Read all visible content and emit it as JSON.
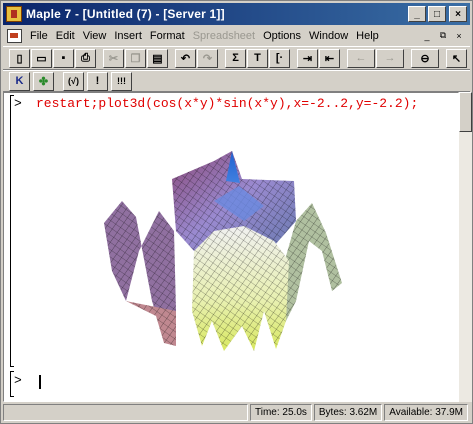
{
  "window": {
    "title": "Maple 7 - [Untitled (7) - [Server 1]]",
    "caption_buttons": [
      "_",
      "□",
      "×"
    ]
  },
  "menu": {
    "items": [
      {
        "label": "File",
        "disabled": false
      },
      {
        "label": "Edit",
        "disabled": false
      },
      {
        "label": "View",
        "disabled": false
      },
      {
        "label": "Insert",
        "disabled": false
      },
      {
        "label": "Format",
        "disabled": false
      },
      {
        "label": "Spreadsheet",
        "disabled": true
      },
      {
        "label": "Options",
        "disabled": false
      },
      {
        "label": "Window",
        "disabled": false
      },
      {
        "label": "Help",
        "disabled": false
      }
    ],
    "mdi_buttons": [
      "_",
      "⧉",
      "×"
    ]
  },
  "toolbar": {
    "buttons": [
      "new",
      "open",
      "save",
      "print",
      "cut",
      "copy",
      "paste",
      "undo",
      "redo",
      "sigma",
      "text",
      "nonexec",
      "indent",
      "outdent",
      "back",
      "forward",
      "stop",
      "help"
    ],
    "glyphs": {
      "new": "▯",
      "open": "▭",
      "save": "▪",
      "print": "⎙",
      "cut": "✂",
      "copy": "❐",
      "paste": "▤",
      "undo": "↶",
      "redo": "↷",
      "sigma": "Σ",
      "text": "T",
      "nonexec": "[·",
      "indent": "⇥",
      "outdent": "⇤",
      "back": "←",
      "forward": "→",
      "stop": "⊖",
      "help": "↖"
    }
  },
  "toolbar2": {
    "buttons": [
      {
        "name": "stop-exec",
        "glyph": "K"
      },
      {
        "name": "restart",
        "glyph": "✤"
      },
      {
        "name": "sqrt",
        "glyph": "(√)"
      },
      {
        "name": "execute",
        "glyph": "!"
      },
      {
        "name": "execute-all",
        "glyph": "!!!"
      }
    ]
  },
  "document": {
    "prompt": ">",
    "command": "restart;plot3d(cos(x*y)*sin(x*y),x=-2..2,y=-2.2);",
    "empty_prompt": ">"
  },
  "status": {
    "time": "Time: 25.0s",
    "bytes": "Bytes: 3.62M",
    "available": "Available: 37.9M"
  },
  "colors": {
    "titlebar_start": "#0a246a",
    "titlebar_end": "#3a6ea5",
    "command_red": "#e00000",
    "chrome": "#d4d0c8"
  }
}
